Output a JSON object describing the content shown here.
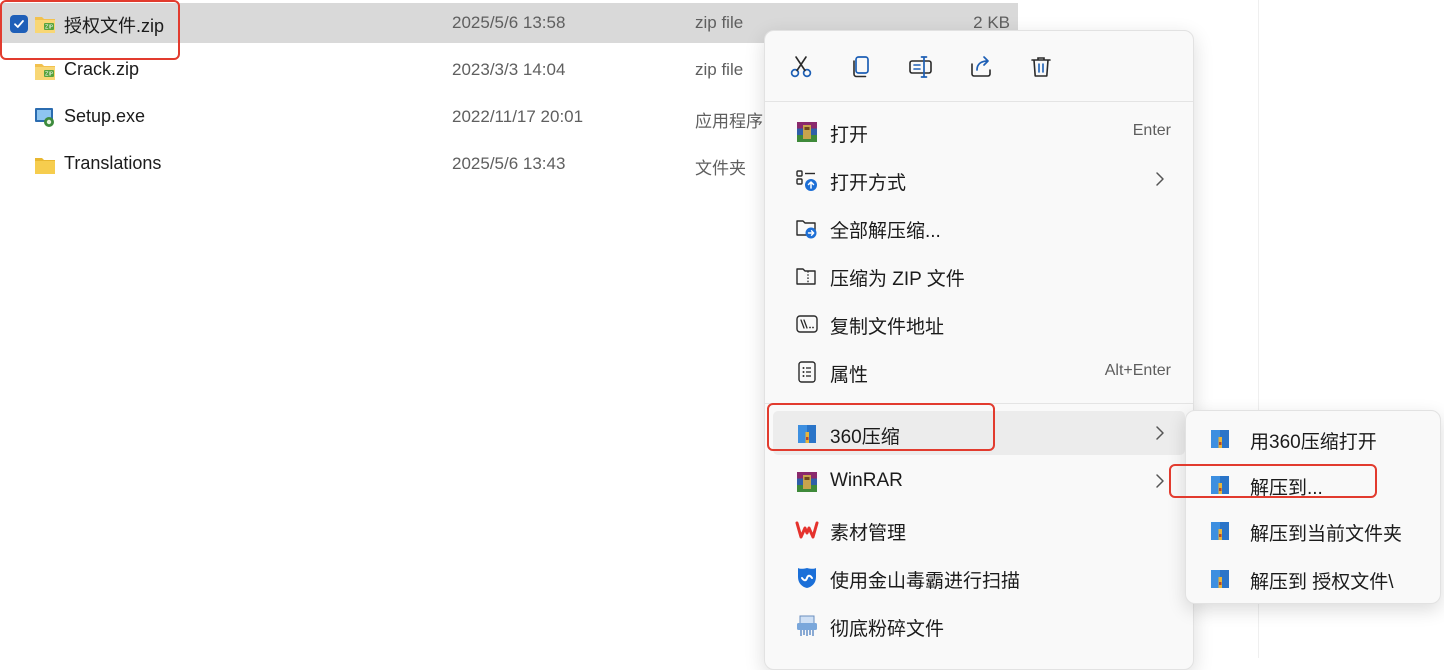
{
  "files": [
    {
      "name": "授权文件.zip",
      "date": "2025/5/6 13:58",
      "type": "zip file",
      "size": "2 KB",
      "icon": "zip-file-icon",
      "selected": true
    },
    {
      "name": "Crack.zip",
      "date": "2023/3/3 14:04",
      "type": "zip file",
      "size": "",
      "icon": "zip-file-icon",
      "selected": false
    },
    {
      "name": "Setup.exe",
      "date": "2022/11/17 20:01",
      "type": "应用程序",
      "size": "",
      "icon": "setup-exe-icon",
      "selected": false
    },
    {
      "name": "Translations",
      "date": "2025/5/6 13:43",
      "type": "文件夹",
      "size": "",
      "icon": "folder-icon",
      "selected": false
    }
  ],
  "context_menu": {
    "quick_actions": [
      {
        "name": "cut",
        "icon": "scissors-icon"
      },
      {
        "name": "copy",
        "icon": "copy-icon"
      },
      {
        "name": "rename",
        "icon": "rename-icon"
      },
      {
        "name": "share",
        "icon": "share-icon"
      },
      {
        "name": "delete",
        "icon": "trash-icon"
      }
    ],
    "items": [
      {
        "label": "打开",
        "shortcut": "Enter",
        "icon": "winrar-icon"
      },
      {
        "label": "打开方式",
        "shortcut": "",
        "icon": "open-with-icon",
        "submenu": true
      },
      {
        "label": "全部解压缩...",
        "shortcut": "",
        "icon": "extract-all-icon"
      },
      {
        "label": "压缩为 ZIP 文件",
        "shortcut": "",
        "icon": "compress-zip-icon"
      },
      {
        "label": "复制文件地址",
        "shortcut": "",
        "icon": "copy-path-icon"
      },
      {
        "label": "属性",
        "shortcut": "Alt+Enter",
        "icon": "properties-icon"
      },
      {
        "label": "360压缩",
        "shortcut": "",
        "icon": "360zip-icon",
        "submenu": true
      },
      {
        "label": "WinRAR",
        "shortcut": "",
        "icon": "winrar-icon",
        "submenu": true
      },
      {
        "label": "素材管理",
        "shortcut": "",
        "icon": "wps-icon"
      },
      {
        "label": "使用金山毒霸进行扫描",
        "shortcut": "",
        "icon": "duba-icon"
      },
      {
        "label": "彻底粉碎文件",
        "shortcut": "",
        "icon": "shredder-icon"
      }
    ]
  },
  "submenu_360": {
    "items": [
      {
        "label": "用360压缩打开",
        "icon": "360zip-icon"
      },
      {
        "label": "解压到...",
        "icon": "360zip-icon"
      },
      {
        "label": "解压到当前文件夹",
        "icon": "360zip-icon"
      },
      {
        "label": "解压到 授权文件\\",
        "icon": "360zip-icon"
      }
    ]
  },
  "colors": {
    "selection": "#d9d9d9",
    "checkbox": "#1f5fb8",
    "highlight_box": "#e23b2e",
    "menu_bg": "#f9f9f9"
  }
}
